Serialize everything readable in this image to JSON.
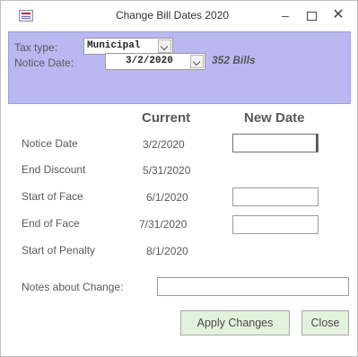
{
  "window": {
    "title": "Change Bill Dates 2020",
    "minimize_glyph": "–",
    "close_glyph": "✕"
  },
  "header": {
    "tax_type_label": "Tax type:",
    "tax_type_value": "Municipal",
    "notice_date_label": "Notice Date:",
    "notice_date_value": "3/2/2020",
    "bills_count": "352 Bills"
  },
  "columns": {
    "current": "Current",
    "new_date": "New Date"
  },
  "rows": [
    {
      "label": "Notice Date",
      "current": "3/2/2020",
      "editable": true
    },
    {
      "label": "End Discount",
      "current": "5/31/2020",
      "editable": false
    },
    {
      "label": "Start of Face",
      "current": "6/1/2020",
      "editable": true
    },
    {
      "label": "End of Face",
      "current": "7/31/2020",
      "editable": true
    },
    {
      "label": "Start of Penalty",
      "current": "8/1/2020",
      "editable": false
    }
  ],
  "notes": {
    "label": "Notes about Change:",
    "value": ""
  },
  "buttons": {
    "apply": "Apply Changes",
    "close": "Close"
  },
  "colors": {
    "header_bg": "#b9b8f0",
    "button_bg": "#e3f2dc"
  }
}
